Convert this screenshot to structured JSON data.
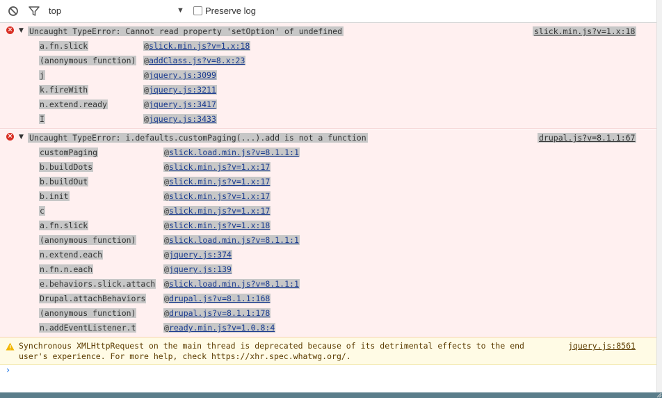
{
  "toolbar": {
    "context": "top",
    "preserve_log_label": "Preserve log"
  },
  "errors": [
    {
      "message": "Uncaught TypeError: Cannot read property 'setOption' of undefined",
      "source": "slick.min.js?v=1.x:18",
      "frames": [
        {
          "fn": "a.fn.slick",
          "loc": "slick.min.js?v=1.x:18"
        },
        {
          "fn": "(anonymous function)",
          "loc": "addClass.js?v=8.x:23"
        },
        {
          "fn": "j",
          "loc": "jquery.js:3099"
        },
        {
          "fn": "k.fireWith",
          "loc": "jquery.js:3211"
        },
        {
          "fn": "n.extend.ready",
          "loc": "jquery.js:3417"
        },
        {
          "fn": "I",
          "loc": "jquery.js:3433"
        }
      ]
    },
    {
      "message": "Uncaught TypeError: i.defaults.customPaging(...).add is not a function",
      "source": "drupal.js?v=8.1.1:67",
      "frames": [
        {
          "fn": "customPaging",
          "loc": "slick.load.min.js?v=8.1.1:1"
        },
        {
          "fn": "b.buildDots",
          "loc": "slick.min.js?v=1.x:17"
        },
        {
          "fn": "b.buildOut",
          "loc": "slick.min.js?v=1.x:17"
        },
        {
          "fn": "b.init",
          "loc": "slick.min.js?v=1.x:17"
        },
        {
          "fn": "c",
          "loc": "slick.min.js?v=1.x:17"
        },
        {
          "fn": "a.fn.slick",
          "loc": "slick.min.js?v=1.x:18"
        },
        {
          "fn": "(anonymous function)",
          "loc": "slick.load.min.js?v=8.1.1:1"
        },
        {
          "fn": "n.extend.each",
          "loc": "jquery.js:374"
        },
        {
          "fn": "n.fn.n.each",
          "loc": "jquery.js:139"
        },
        {
          "fn": "e.behaviors.slick.attach",
          "loc": "slick.load.min.js?v=8.1.1:1"
        },
        {
          "fn": "Drupal.attachBehaviors",
          "loc": "drupal.js?v=8.1.1:168"
        },
        {
          "fn": "(anonymous function)",
          "loc": "drupal.js?v=8.1.1:178"
        },
        {
          "fn": "n.addEventListener.t",
          "loc": "ready.min.js?v=1.0.8:4"
        }
      ]
    }
  ],
  "warning": {
    "message": "Synchronous XMLHttpRequest on the main thread is deprecated because of its detrimental effects to the end user's experience. For more help, check https://xhr.spec.whatwg.org/.",
    "source": "jquery.js:8561"
  },
  "prompt_symbol": "›",
  "at_symbol": "@",
  "colors": {
    "error_bg": "#fff0f0",
    "warning_bg": "#fffbe5",
    "link": "#1a3a8f",
    "selection": "#c7c7c7"
  }
}
